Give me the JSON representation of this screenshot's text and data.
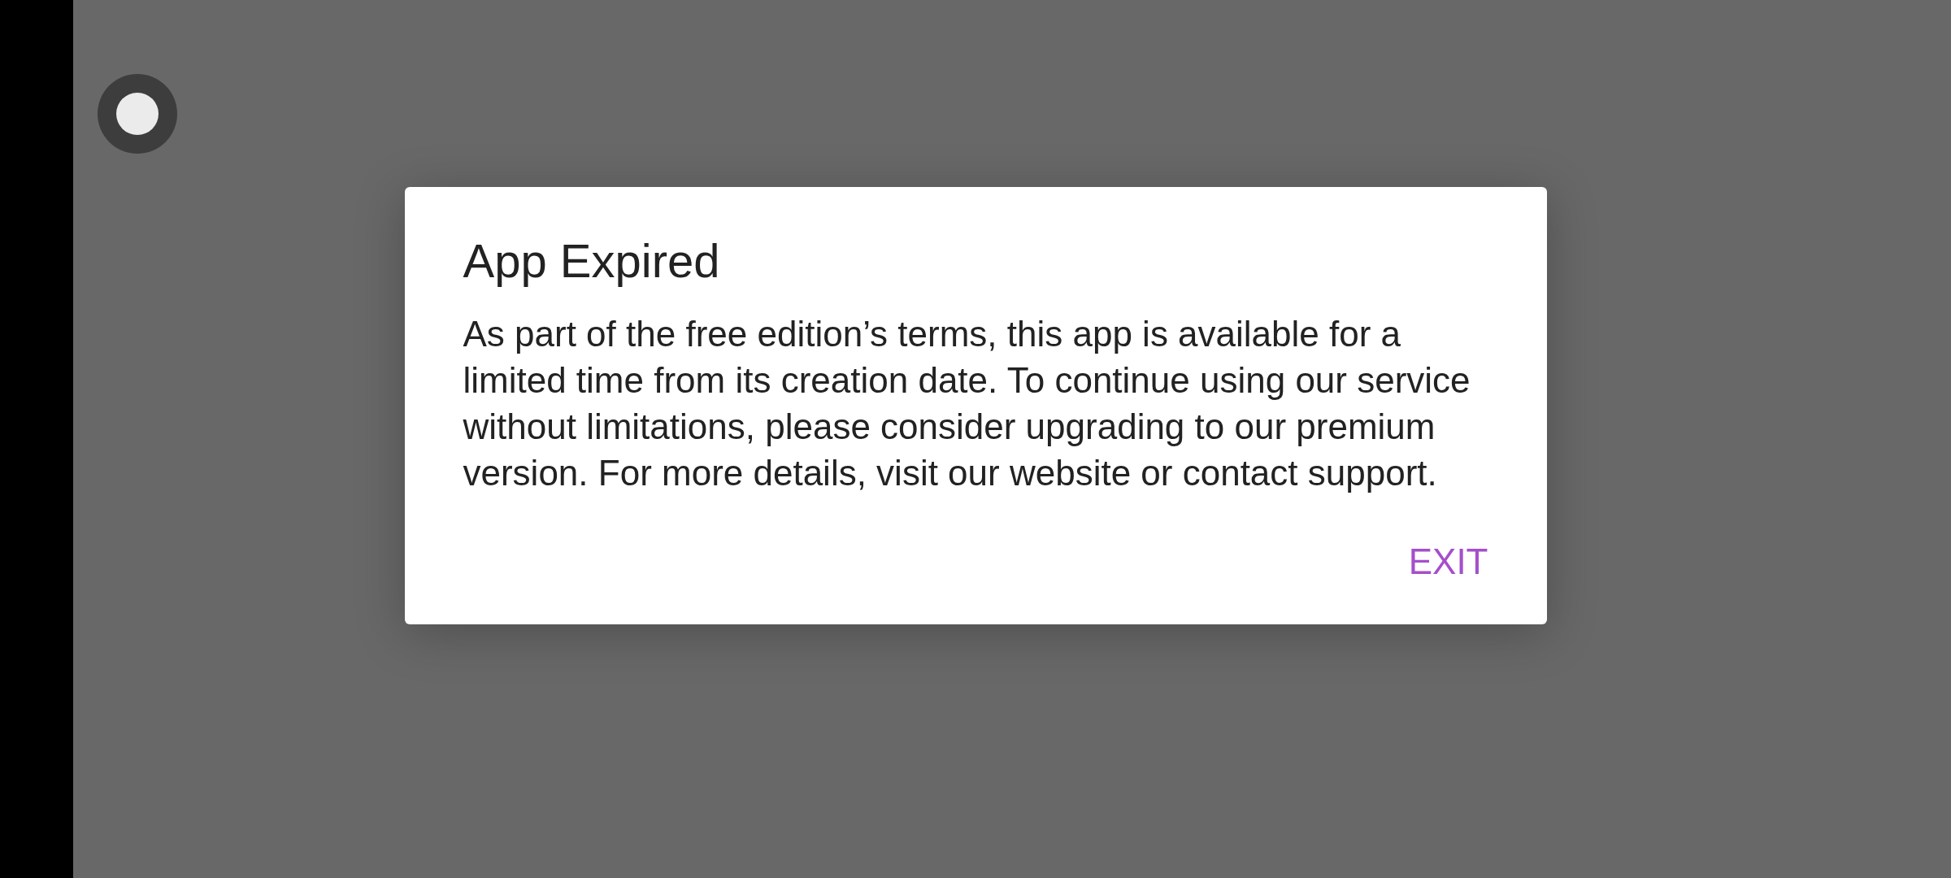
{
  "dialog": {
    "title": "App Expired",
    "message": "As part of the free edition’s terms, this app is available for a limited time from its creation date. To continue using our service without limitations, please consider upgrading to our premium version. For more details, visit our website or contact support.",
    "buttons": [
      "EXIT"
    ]
  }
}
